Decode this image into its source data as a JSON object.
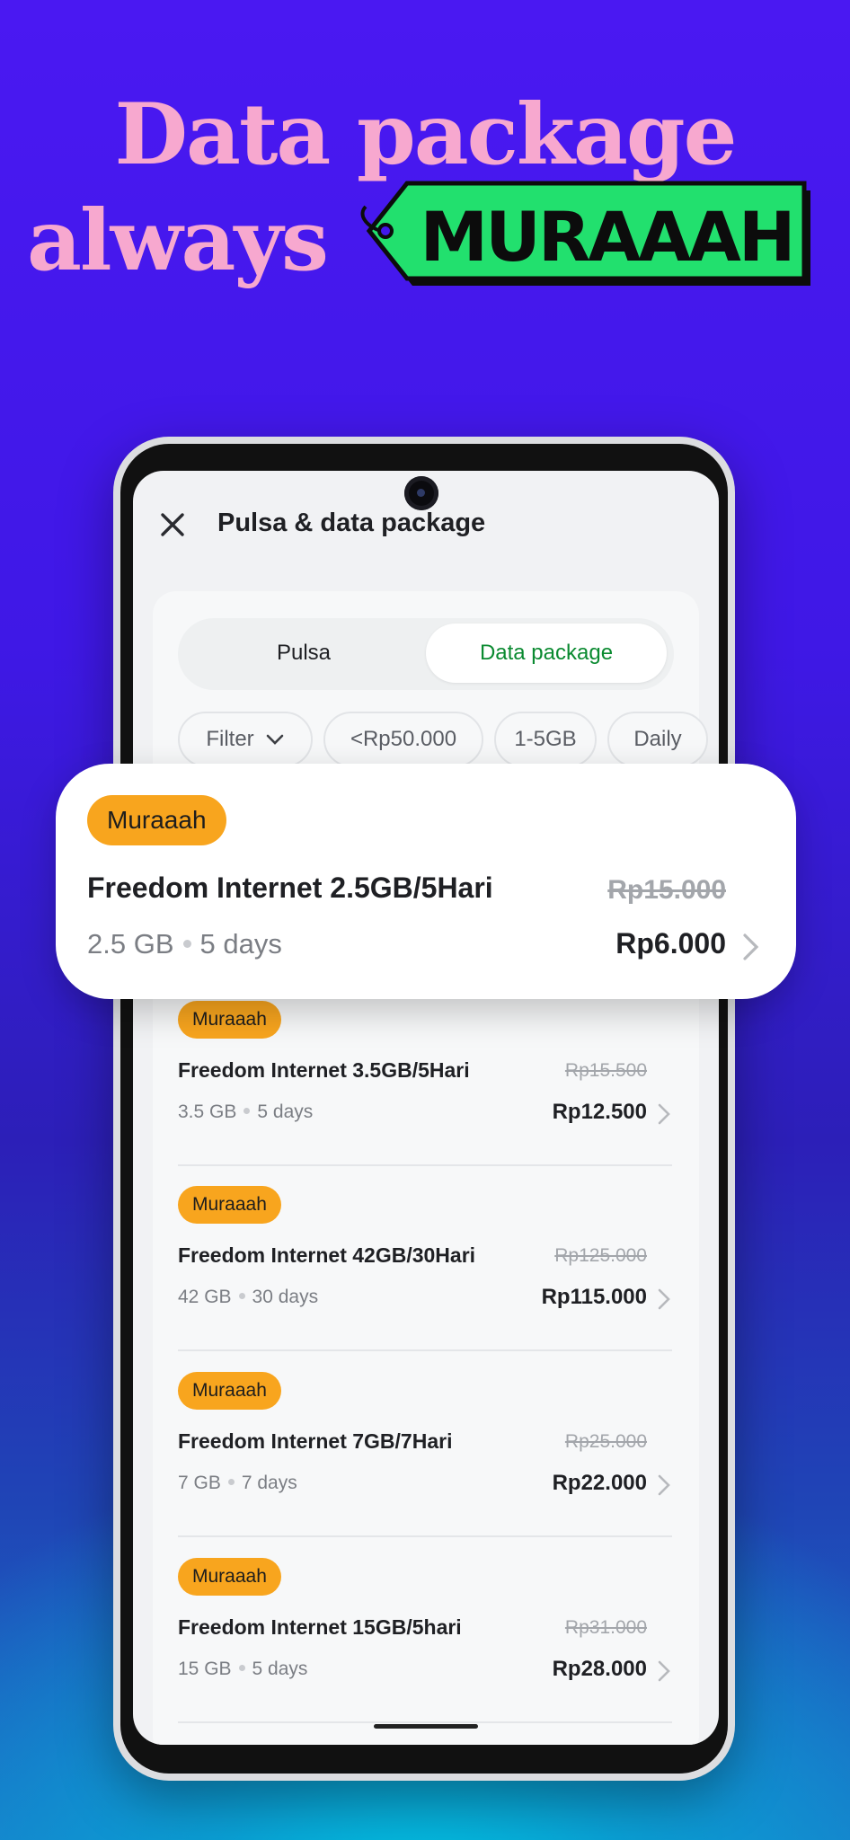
{
  "headline": {
    "line1": "Data package",
    "line2": "always",
    "tag_text": "MURAAAH"
  },
  "colors": {
    "background": "#4218EC",
    "headline": "#F7A8CF",
    "tag_fill": "#22E06E",
    "badge": "#F8A51E",
    "active_tab_text": "#0A8A30"
  },
  "app": {
    "close_icon": "close-icon",
    "title": "Pulsa & data package",
    "tabs": [
      {
        "label": "Pulsa",
        "active": false
      },
      {
        "label": "Data package",
        "active": true
      }
    ],
    "filters": {
      "filter_label": "Filter",
      "chips": [
        "<Rp50.000",
        "1-5GB",
        "Daily"
      ]
    }
  },
  "highlight": {
    "badge": "Muraaah",
    "name": "Freedom Internet 2.5GB/5Hari",
    "old_price": "Rp15.000",
    "size": "2.5 GB",
    "duration": "5 days",
    "price": "Rp6.000"
  },
  "packages": [
    {
      "badge": "Muraaah",
      "name": "Freedom Internet 3.5GB/5Hari",
      "old_price": "Rp15.500",
      "size": "3.5 GB",
      "duration": "5 days",
      "price": "Rp12.500"
    },
    {
      "badge": "Muraaah",
      "name": "Freedom Internet 42GB/30Hari",
      "old_price": "Rp125.000",
      "size": "42 GB",
      "duration": "30 days",
      "price": "Rp115.000"
    },
    {
      "badge": "Muraaah",
      "name": "Freedom Internet 7GB/7Hari",
      "old_price": "Rp25.000",
      "size": "7 GB",
      "duration": "7 days",
      "price": "Rp22.000"
    },
    {
      "badge": "Muraaah",
      "name": "Freedom Internet 15GB/5hari",
      "old_price": "Rp31.000",
      "size": "15 GB",
      "duration": "5 days",
      "price": "Rp28.000"
    }
  ]
}
